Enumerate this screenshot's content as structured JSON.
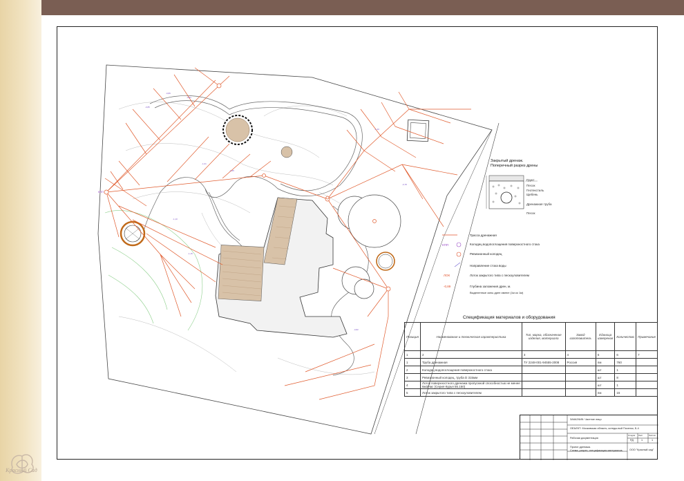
{
  "branding": {
    "logo_text": "Красный Сад"
  },
  "section": {
    "title_line1": "Закрытый дренаж.",
    "title_line2": "Поперечный разрез дрены",
    "labels": [
      "Грунт",
      "Песок",
      "Геотекстиль",
      "Щебень",
      "Дренажная труба",
      "Песок"
    ]
  },
  "legend": [
    {
      "label": "Трасса дренажная",
      "color": "#e0502a"
    },
    {
      "label": "Колодец водопоглощения поверхностного стока",
      "code": "КПП",
      "color": "#9b4fc7"
    },
    {
      "label": "Ревизионный колодец",
      "color": "#e0502a"
    },
    {
      "label": "Направление стока воды",
      "color": "#6b5bd0"
    },
    {
      "label": "Лоток закрытого типа с пескоуловителем",
      "code": "ЛОК",
      "color": "#e0502a"
    },
    {
      "label": "Глубина заложения дрен, м.",
      "code": "-0,89",
      "color": "#e0502a"
    },
    {
      "label": "Выделенные зоны дрен имеют (1м ко 1м)",
      "color": "#222"
    }
  ],
  "spec": {
    "title": "Спецификация материалов и оборудования",
    "headers": [
      "Позиция",
      "Наименование и техническая характеристика",
      "Тип, марка, обозначение изделия, материала",
      "Завод изготовитель",
      "Единица измерения",
      "Количество",
      "Примечание"
    ],
    "numbers": [
      "1",
      "2",
      "3",
      "4",
      "5",
      "6",
      "7"
    ],
    "rows": [
      [
        "1",
        "Труба дренажная",
        "ТУ 2248-001-94555-2008",
        "Россия",
        "пм",
        "760",
        ""
      ],
      [
        "2",
        "Колодец водопоглощения поверхностного стока",
        "",
        "",
        "шт",
        "1",
        ""
      ],
      [
        "3",
        "Ревизионный колодец, труба D 315мм",
        "",
        "",
        "шт",
        "8",
        ""
      ],
      [
        "4",
        "Лоток поверхностного дренажа пропускной способностью не менее 6м3/час (Серия Курья 55.150)",
        "",
        "",
        "шт",
        "1",
        ""
      ],
      [
        "5",
        "Лоток закрытого типа с пескоуловителем",
        "",
        "",
        "пм",
        "15",
        ""
      ]
    ]
  },
  "stamp": {
    "customer": "ЗАКАЗЧИК: Частное лицо",
    "object": "ОБЪЕКТ: Московская область, котедж-ный Поселок, Б-4",
    "stage_label": "Рабочая документация",
    "stage": "Стадия",
    "sheet": "Лист",
    "sheets": "Листов",
    "stage_val": "РД",
    "sheet_val": "1",
    "sheets_val": "1",
    "drawing": "Проект дренажа.",
    "drawing2": "Схема, разрез, спецификация материалов.",
    "company": "ООО \"Красный сад\""
  },
  "map_labels": {
    "kpp": "КПП",
    "depth_values": [
      "-0,85",
      "-0,89",
      "-0,93",
      "-1,01",
      "-1,05",
      "-1,10",
      "-1,15",
      "-1,20",
      "-0,78",
      "-0,82"
    ]
  }
}
